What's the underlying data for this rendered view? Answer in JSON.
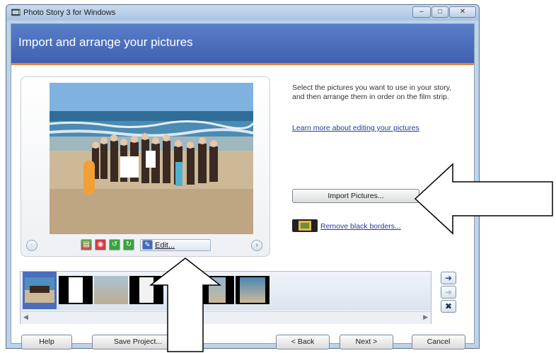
{
  "window": {
    "title": "Photo Story 3 for Windows",
    "controls": [
      "minimize",
      "maximize",
      "close"
    ]
  },
  "header": {
    "title": "Import and arrange your pictures"
  },
  "instructions": {
    "text": "Select the pictures you want to use in your story, and then arrange them in order on the film strip.",
    "learn_link": "Learn more about editing your pictures"
  },
  "actions": {
    "import_label": "Import Pictures...",
    "remove_borders_label": "Remove black borders...",
    "edit_label": "Edit..."
  },
  "photo_toolbar": {
    "icons": [
      "auto-correct-icon",
      "red-eye-icon",
      "rotate-left-icon",
      "rotate-right-icon",
      "edit-icon"
    ]
  },
  "filmstrip": {
    "thumbnails": [
      "beach-group",
      "document-page",
      "beach-shore",
      "document-page-2",
      "beach-figures",
      "beach-people"
    ],
    "selected_index": 0
  },
  "footer": {
    "help_label": "Help",
    "save_label": "Save Project...",
    "back_label": "< Back",
    "next_label": "Next >",
    "cancel_label": "Cancel"
  },
  "colors": {
    "banner": "#4a6dbd",
    "banner_accent": "#e7833b",
    "link": "#1f3f9c"
  }
}
